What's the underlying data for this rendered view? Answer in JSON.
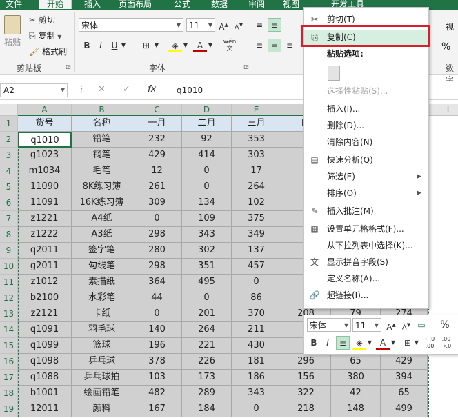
{
  "tabs": [
    "文件",
    "开始",
    "插入",
    "页面布局",
    "公式",
    "数据",
    "审阅",
    "视图",
    "开发工具"
  ],
  "ribbon": {
    "paste_label": "粘贴",
    "cut_label": "剪切",
    "copy_label": "复制",
    "format_painter_label": "格式刷",
    "clipboard_group": "剪贴板",
    "font_name": "宋体",
    "font_size": "11",
    "font_group": "字体",
    "bold": "B",
    "italic": "I",
    "underline": "U",
    "wen_label": "wén 文",
    "view_partial": "视",
    "number_group_partial": "数字",
    "percent": "%"
  },
  "formula_bar": {
    "name_box": "A2",
    "fx": "fx",
    "value": "q1010"
  },
  "grid": {
    "columns": [
      "A",
      "B",
      "C",
      "D",
      "E",
      "F",
      "G",
      "H",
      "I"
    ],
    "rows": [
      [
        "货号",
        "名称",
        "一月",
        "二月",
        "三月",
        "四",
        "",
        ""
      ],
      [
        "q1010",
        "铅笔",
        "232",
        "92",
        "353",
        "8",
        "",
        ""
      ],
      [
        "g1023",
        "钢笔",
        "429",
        "414",
        "303",
        "1",
        "",
        ""
      ],
      [
        "m1034",
        "毛笔",
        "12",
        "0",
        "17",
        "",
        "",
        ""
      ],
      [
        "11090",
        "8K练习簿",
        "261",
        "0",
        "264",
        "2",
        "",
        ""
      ],
      [
        "11091",
        "16K练习簿",
        "309",
        "134",
        "102",
        "2",
        "",
        ""
      ],
      [
        "z1221",
        "A4纸",
        "0",
        "109",
        "375",
        "1",
        "",
        ""
      ],
      [
        "z1222",
        "A3纸",
        "298",
        "343",
        "349",
        "3",
        "",
        ""
      ],
      [
        "q2011",
        "签字笔",
        "280",
        "302",
        "137",
        "2",
        "",
        ""
      ],
      [
        "g2011",
        "勾线笔",
        "298",
        "351",
        "457",
        "3",
        "",
        ""
      ],
      [
        "z1012",
        "素描纸",
        "364",
        "495",
        "0",
        "2",
        "",
        ""
      ],
      [
        "b2100",
        "水彩笔",
        "44",
        "0",
        "86",
        "4",
        "",
        ""
      ],
      [
        "z2121",
        "卡纸",
        "0",
        "201",
        "370",
        "208",
        "79",
        "274"
      ],
      [
        "q1091",
        "羽毛球",
        "140",
        "264",
        "211",
        "1",
        "",
        ""
      ],
      [
        "q1099",
        "篮球",
        "196",
        "221",
        "430",
        "8",
        "",
        ""
      ],
      [
        "q1098",
        "乒乓球",
        "378",
        "226",
        "181",
        "296",
        "65",
        "429"
      ],
      [
        "q1088",
        "乒乓球拍",
        "103",
        "173",
        "186",
        "156",
        "380",
        "394"
      ],
      [
        "b1001",
        "绘画铅笔",
        "482",
        "289",
        "343",
        "322",
        "42",
        "65"
      ],
      [
        "12011",
        "颜料",
        "167",
        "184",
        "0",
        "218",
        "148",
        "499"
      ]
    ]
  },
  "context_menu": {
    "items": [
      {
        "icon": "✂",
        "label": "剪切(T)",
        "state": "normal"
      },
      {
        "icon": "⎘",
        "label": "复制(C)",
        "state": "highlighted"
      },
      {
        "icon": "",
        "label": "粘贴选项:",
        "state": "bold"
      },
      {
        "icon": "",
        "label": "",
        "state": "paste-icon"
      },
      {
        "icon": "",
        "label": "选择性粘贴(S)...",
        "state": "disabled"
      },
      {
        "icon": "",
        "label": "插入(I)...",
        "state": "normal"
      },
      {
        "icon": "",
        "label": "删除(D)...",
        "state": "normal"
      },
      {
        "icon": "",
        "label": "清除内容(N)",
        "state": "normal"
      },
      {
        "icon": "▤",
        "label": "快速分析(Q)",
        "state": "normal"
      },
      {
        "icon": "",
        "label": "筛选(E)",
        "state": "submenu"
      },
      {
        "icon": "",
        "label": "排序(O)",
        "state": "submenu"
      },
      {
        "icon": "✎",
        "label": "插入批注(M)",
        "state": "normal"
      },
      {
        "icon": "▦",
        "label": "设置单元格格式(F)...",
        "state": "normal"
      },
      {
        "icon": "",
        "label": "从下拉列表中选择(K)...",
        "state": "normal"
      },
      {
        "icon": "文",
        "label": "显示拼音字段(S)",
        "state": "normal"
      },
      {
        "icon": "",
        "label": "定义名称(A)...",
        "state": "normal"
      },
      {
        "icon": "🔗",
        "label": "超链接(I)...",
        "state": "normal"
      }
    ]
  },
  "mini_toolbar": {
    "font_name": "宋体",
    "font_size": "11",
    "percent": "%"
  },
  "colors": {
    "accent": "#217346",
    "highlight_border": "#d61f2a",
    "selection_fill": "#d0d0d0"
  }
}
